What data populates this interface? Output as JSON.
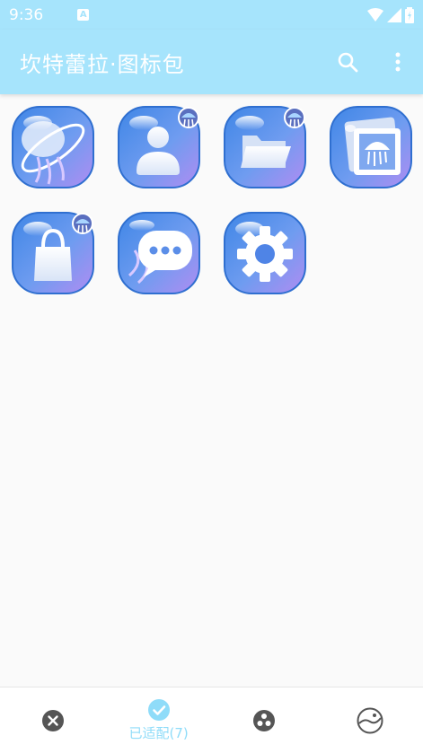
{
  "status_bar": {
    "time": "9:36",
    "indicator": "A"
  },
  "app_bar": {
    "title": "坎特蕾拉·图标包",
    "icons": [
      "search-icon",
      "more-vert-icon"
    ]
  },
  "colors": {
    "accent": "#a6e4fc",
    "active_nav": "#8fdcf9",
    "inactive_nav": "#555555",
    "icon_blue": "#4a8fe6",
    "icon_purple": "#a98cf0"
  },
  "icons": [
    {
      "name": "browser-jellyfish-icon",
      "badge": false
    },
    {
      "name": "contacts-icon",
      "badge": true
    },
    {
      "name": "file-manager-icon",
      "badge": true
    },
    {
      "name": "gallery-jellyfish-icon",
      "badge": false
    },
    {
      "name": "store-bag-icon",
      "badge": true
    },
    {
      "name": "messages-icon",
      "badge": false
    },
    {
      "name": "settings-gear-icon",
      "badge": false
    }
  ],
  "bottom_nav": [
    {
      "name": "unadapted-tab",
      "icon": "close-circle-icon",
      "label": "",
      "active": false
    },
    {
      "name": "adapted-tab",
      "icon": "check-circle-icon",
      "label": "已适配(7)",
      "active": true
    },
    {
      "name": "themes-tab",
      "icon": "dots-circle-icon",
      "label": "",
      "active": false
    },
    {
      "name": "wallpaper-tab",
      "icon": "wallpaper-circle-icon",
      "label": "",
      "active": false
    }
  ]
}
